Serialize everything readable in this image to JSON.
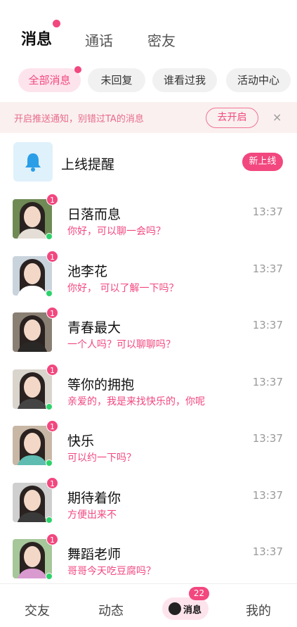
{
  "top_tabs": [
    {
      "label": "消息",
      "active": true,
      "has_dot": true
    },
    {
      "label": "通话",
      "active": false,
      "has_dot": false
    },
    {
      "label": "密友",
      "active": false,
      "has_dot": false
    }
  ],
  "filter_chips": [
    {
      "label": "全部消息",
      "active": true,
      "has_dot": true
    },
    {
      "label": "未回复",
      "active": false,
      "has_dot": false
    },
    {
      "label": "谁看过我",
      "active": false,
      "has_dot": false
    },
    {
      "label": "活动中心",
      "active": false,
      "has_dot": false
    }
  ],
  "push_banner": {
    "text": "开启推送通知，别错过TA的消息",
    "button_label": "去开启",
    "close_icon": "×"
  },
  "online_reminder": {
    "icon": "bell-icon",
    "title": "上线提醒",
    "badge": "新上线"
  },
  "messages": [
    {
      "name": "日落而息",
      "preview": "你好，可以聊一会吗？",
      "time": "13:37",
      "unread": "1",
      "online": true,
      "colors": {
        "bg": "#6f8a55",
        "top": "#e4ded6"
      }
    },
    {
      "name": "池李花",
      "preview": "你好，  可以了解一下吗？",
      "time": "13:37",
      "unread": "1",
      "online": true,
      "colors": {
        "bg": "#c9d3dc",
        "top": "#ffffff"
      }
    },
    {
      "name": "青春最大",
      "preview": "一个人吗？可以聊聊吗？",
      "time": "13:37",
      "unread": "1",
      "online": false,
      "colors": {
        "bg": "#8a7f73",
        "top": "#2a2826"
      }
    },
    {
      "name": "等你的拥抱",
      "preview": "亲爱的，我是来找快乐的，你呢",
      "time": "13:37",
      "unread": "1",
      "online": true,
      "colors": {
        "bg": "#d9d4cc",
        "top": "#444444"
      }
    },
    {
      "name": "快乐",
      "preview": "可以约一下吗？",
      "time": "13:37",
      "unread": "1",
      "online": true,
      "colors": {
        "bg": "#c8b7a5",
        "top": "#5fbcb0"
      }
    },
    {
      "name": "期待着你",
      "preview": "方便出来不",
      "time": "13:37",
      "unread": "1",
      "online": true,
      "colors": {
        "bg": "#cfcfcf",
        "top": "#3a3a3a"
      }
    },
    {
      "name": "舞蹈老师",
      "preview": "哥哥今天吃豆腐吗？",
      "time": "13:37",
      "unread": "1",
      "online": true,
      "colors": {
        "bg": "#a6c79a",
        "top": "#d99ad0"
      }
    }
  ],
  "bottom_nav": [
    {
      "label": "交友",
      "active": false
    },
    {
      "label": "动态",
      "active": false
    },
    {
      "label": "消息",
      "active": true,
      "badge": "22"
    },
    {
      "label": "我的",
      "active": false
    }
  ],
  "colors": {
    "accent": "#f2477f",
    "online": "#2bd36a",
    "banner_bg": "#faf0ef",
    "reminder_icon_bg": "#dff1fb",
    "bell": "#2a9ee6"
  }
}
